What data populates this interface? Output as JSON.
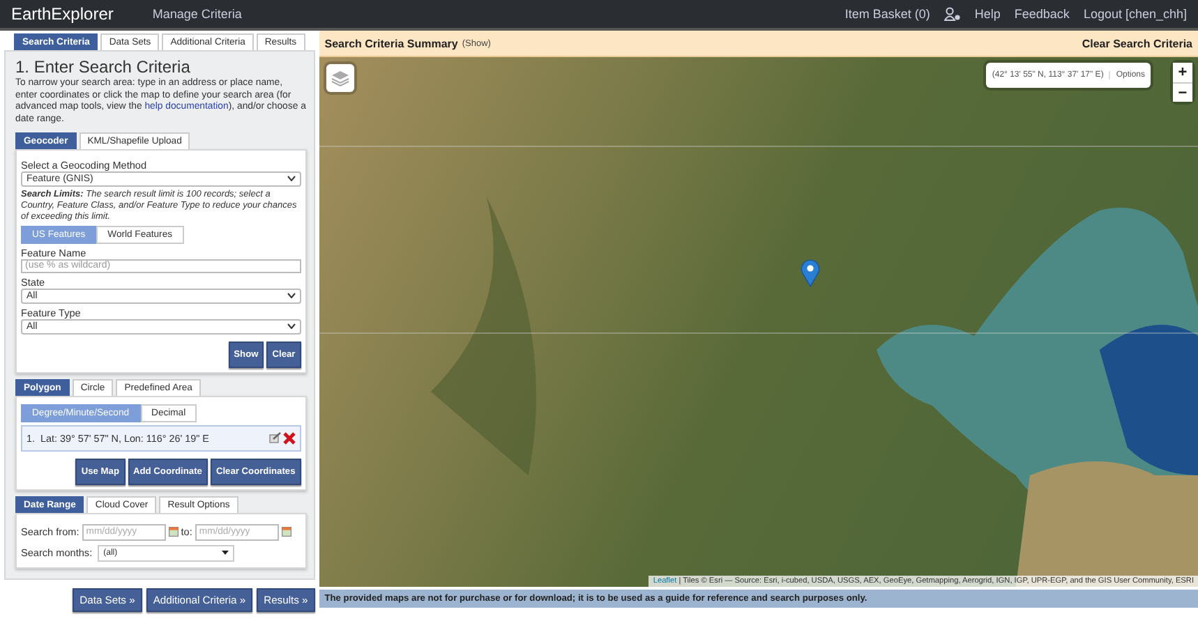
{
  "header": {
    "logo": "EarthExplorer",
    "manage": "Manage Criteria",
    "basket": "Item Basket (0)",
    "links": [
      "Help",
      "Feedback",
      "Logout [chen_chh]"
    ]
  },
  "tabs": [
    {
      "label": "Search Criteria",
      "selected": true
    },
    {
      "label": "Data Sets",
      "selected": false
    },
    {
      "label": "Additional Criteria",
      "selected": false
    },
    {
      "label": "Results",
      "selected": false
    }
  ],
  "criteria": {
    "title": "1. Enter Search Criteria",
    "intro_before": "To narrow your search area: type in an address or place name, enter coordinates or click the map to define your search area (for advanced map tools, view the ",
    "help_link": "help documentation",
    "intro_after": "), and/or choose a date range."
  },
  "geo_tabs": [
    {
      "label": "Geocoder",
      "selected": true
    },
    {
      "label": "KML/Shapefile Upload",
      "selected": false
    }
  ],
  "geocoder": {
    "method_label": "Select a Geocoding Method",
    "method_value": "Feature (GNIS)",
    "limits": "**Search Limits:** The search result limit is 100 records; select a Country, Feature Class, and/or Feature Type to reduce your chances of exceeding this limit.",
    "feature_tabs": [
      {
        "label": "US Features",
        "selected": true
      },
      {
        "label": "World Features",
        "selected": false
      }
    ],
    "name_label": "Feature Name",
    "name_placeholder": "(use % as wildcard)",
    "state_label": "State",
    "state_value": "All",
    "type_label": "Feature Type",
    "type_value": "All",
    "buttons": [
      "Show",
      "Clear"
    ]
  },
  "area_tabs": [
    {
      "label": "Polygon",
      "selected": true
    },
    {
      "label": "Circle",
      "selected": false
    },
    {
      "label": "Predefined Area",
      "selected": false
    }
  ],
  "format_tabs": [
    {
      "label": "Degree/Minute/Second",
      "selected": true
    },
    {
      "label": "Decimal",
      "selected": false
    }
  ],
  "coordinates": [
    {
      "number": "1.",
      "text": "Lat: 39° 57' 57\" N, Lon: 116° 26' 19\" E"
    }
  ],
  "coord_buttons": [
    "Use Map",
    "Add Coordinate",
    "Clear Coordinates"
  ],
  "date_tabs": [
    {
      "label": "Date Range",
      "selected": true
    },
    {
      "label": "Cloud Cover",
      "selected": false
    },
    {
      "label": "Result Options",
      "selected": false
    }
  ],
  "dates": {
    "from_label": "Search from:",
    "from_placeholder": "mm/dd/yyyy",
    "to_label": "to:",
    "to_placeholder": "mm/dd/yyyy",
    "months_label": "Search months:",
    "months_value": "(all)"
  },
  "nav_buttons": [
    "Data Sets »",
    "Additional Criteria »",
    "Results »"
  ],
  "map": {
    "summary_title": "Search Criteria Summary",
    "summary_show": "(Show)",
    "clear": "Clear Search Criteria",
    "cursor": "(42° 13' 55\" N, 113° 37' 17\" E)",
    "options": "Options",
    "zoom_in": "+",
    "zoom_out": "−",
    "attribution_link": "Leaflet",
    "attribution": "| Tiles © Esri — Source: Esri, i-cubed, USDA, USGS, AEX, GeoEye, Getmapping, Aerogrid, IGN, IGP, UPR-EGP, and the GIS User Community, ESRI",
    "disclaimer": "The provided maps are not for purchase or for download; it is to be used as a guide for reference and search purposes only."
  }
}
